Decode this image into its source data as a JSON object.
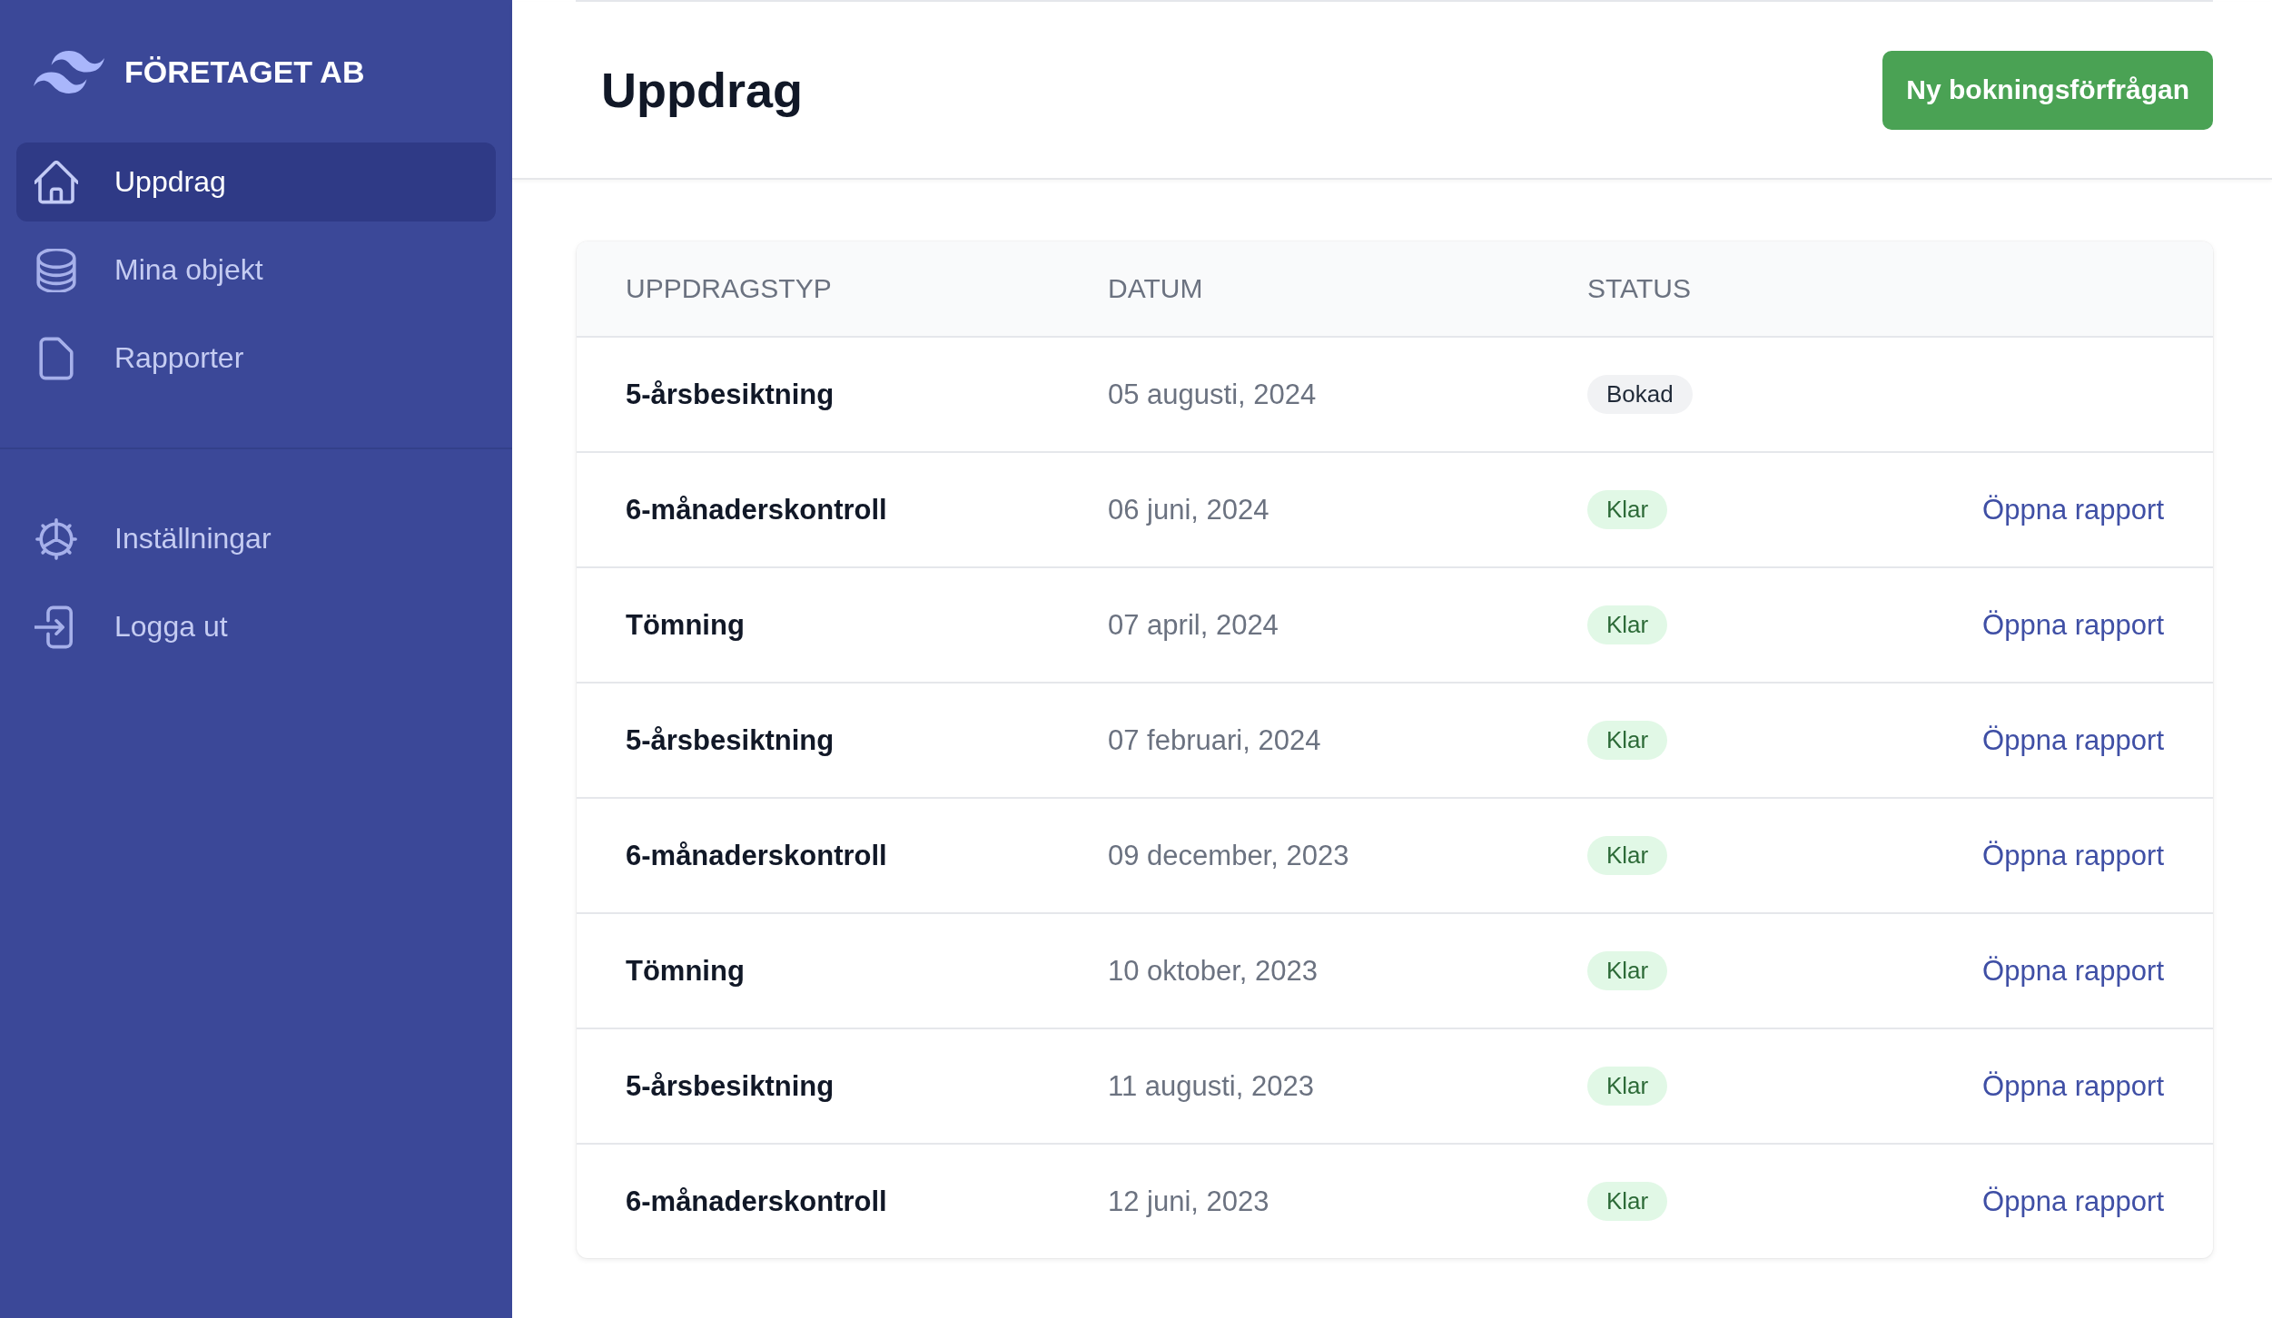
{
  "sidebar": {
    "brand": "FÖRETAGET AB",
    "nav": [
      {
        "label": "Uppdrag",
        "selected": true
      },
      {
        "label": "Mina objekt",
        "selected": false
      },
      {
        "label": "Rapporter",
        "selected": false
      }
    ],
    "secondary_nav": [
      {
        "label": "Inställningar",
        "selected": false
      },
      {
        "label": "Logga ut",
        "selected": false
      }
    ]
  },
  "header": {
    "title": "Uppdrag",
    "primary_button": "Ny bokningsförfrågan"
  },
  "table": {
    "columns": [
      "UPPDRAGSTYP",
      "DATUM",
      "STATUS"
    ],
    "rows": [
      {
        "type": "5-årsbesiktning",
        "date": "05 augusti, 2024",
        "status": {
          "label": "Bokad",
          "kind": "booked"
        }
      },
      {
        "type": "6-månaderskontroll",
        "date": "06 juni, 2024",
        "status": {
          "label": "Klar",
          "kind": "done"
        },
        "link": "Öppna rapport"
      },
      {
        "type": "Tömning",
        "date": "07 april, 2024",
        "status": {
          "label": "Klar",
          "kind": "done"
        },
        "link": "Öppna rapport"
      },
      {
        "type": "5-årsbesiktning",
        "date": "07 februari, 2024",
        "status": {
          "label": "Klar",
          "kind": "done"
        },
        "link": "Öppna rapport"
      },
      {
        "type": "6-månaderskontroll",
        "date": "09 december, 2023",
        "status": {
          "label": "Klar",
          "kind": "done"
        },
        "link": "Öppna rapport"
      },
      {
        "type": "Tömning",
        "date": "10 oktober, 2023",
        "status": {
          "label": "Klar",
          "kind": "done"
        },
        "link": "Öppna rapport"
      },
      {
        "type": "5-årsbesiktning",
        "date": "11 augusti, 2023",
        "status": {
          "label": "Klar",
          "kind": "done"
        },
        "link": "Öppna rapport"
      },
      {
        "type": "6-månaderskontroll",
        "date": "12 juni, 2023",
        "status": {
          "label": "Klar",
          "kind": "done"
        },
        "link": "Öppna rapport"
      }
    ]
  }
}
